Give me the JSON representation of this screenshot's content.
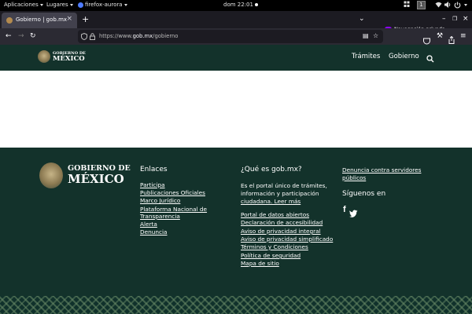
{
  "system_bar": {
    "apps_menu": "Aplicaciones",
    "places_menu": "Lugares",
    "app_name": "firefox-aurora",
    "clock": "dom 22:01",
    "workspace": "1"
  },
  "browser": {
    "tab_title": "Gobierno | gob.mx",
    "private_label": "Navegación privada",
    "url_prefix": "https://www.",
    "url_host": "gob.mx",
    "url_path": "/gobierno"
  },
  "site_header": {
    "logo_line1": "GOBIERNO DE",
    "logo_line2": "MÉXICO",
    "nav": [
      "Trámites",
      "Gobierno"
    ]
  },
  "footer": {
    "logo_line1": "GOBIERNO DE",
    "logo_line2": "MÉXICO",
    "enlaces_title": "Enlaces",
    "enlaces": [
      "Participa",
      "Publicaciones Oficiales",
      "Marco Jurídico",
      "Plataforma Nacional de",
      "Transparencia",
      "Alerta",
      "Denuncia"
    ],
    "que_es_title": "¿Qué es gob.mx?",
    "que_es_text": [
      "Es el portal único de trámites,",
      "información y participación",
      "ciudadana. Leer más"
    ],
    "portal_links": [
      "Portal de datos abiertos",
      "Declaración de accesibilidad",
      "Aviso de privacidad integral",
      "Aviso de privacidad simplificado",
      "Términos y Condiciones",
      "Política de seguridad",
      "Mapa de sitio"
    ],
    "denuncia_lines": [
      "Denuncia contra servidores",
      "públicos"
    ],
    "siguenos_title": "Síguenos en"
  }
}
